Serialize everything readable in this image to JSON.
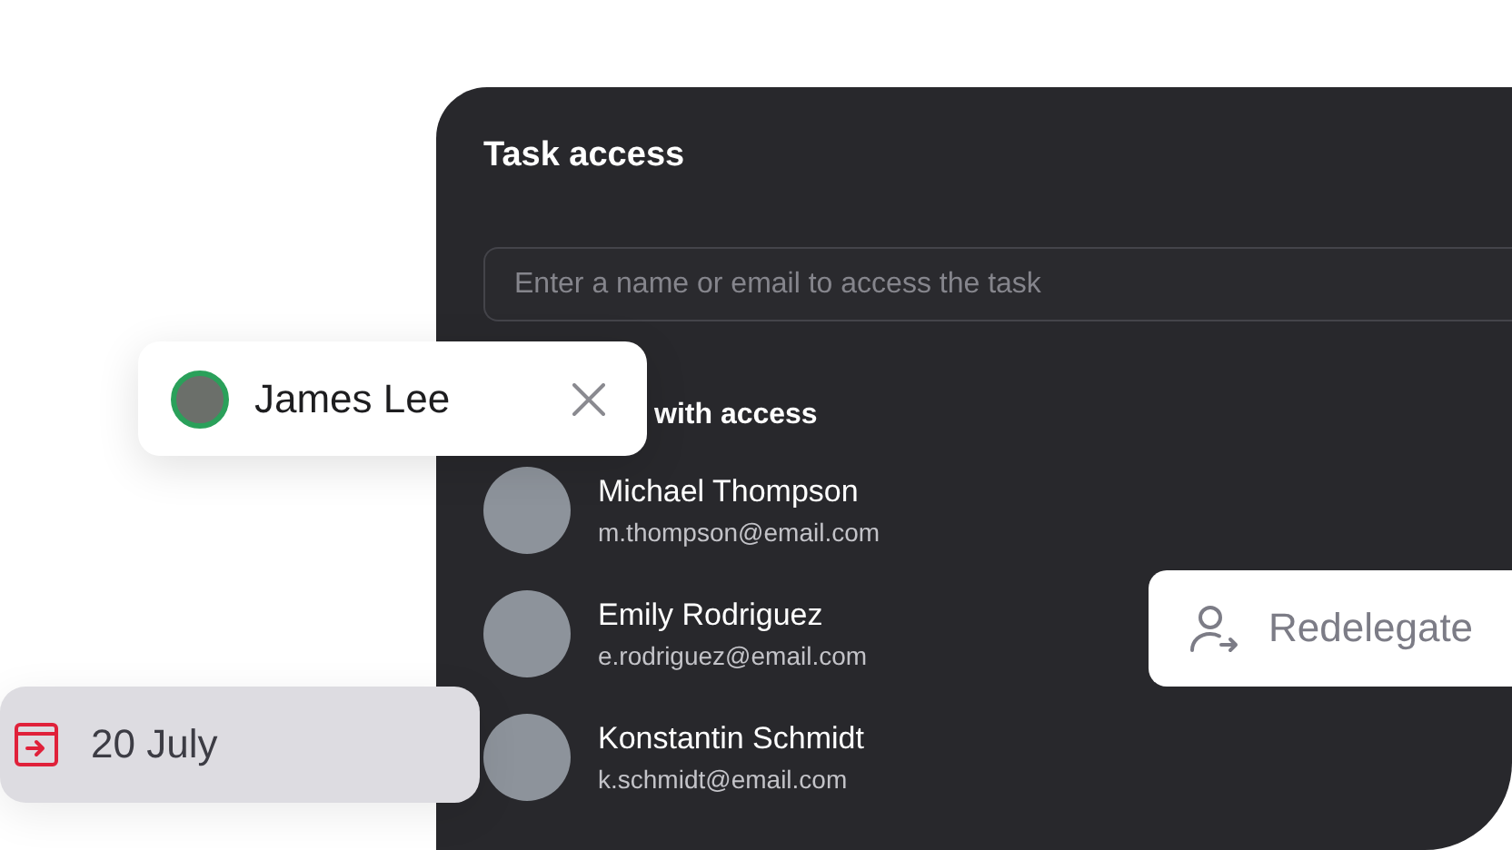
{
  "panel": {
    "title": "Task access",
    "search": {
      "placeholder": "Enter a name or email to access the task"
    },
    "heading": "with access",
    "people": [
      {
        "name": "Michael Thompson",
        "email": "m.thompson@email.com"
      },
      {
        "name": "Emily Rodriguez",
        "email": "e.rodriguez@email.com"
      },
      {
        "name": "Konstantin Schmidt",
        "email": "k.schmidt@email.com"
      }
    ]
  },
  "chip": {
    "name": "James Lee"
  },
  "due_date": {
    "label": "20 July"
  },
  "redelegate_button": {
    "label": "Redelegate"
  }
}
